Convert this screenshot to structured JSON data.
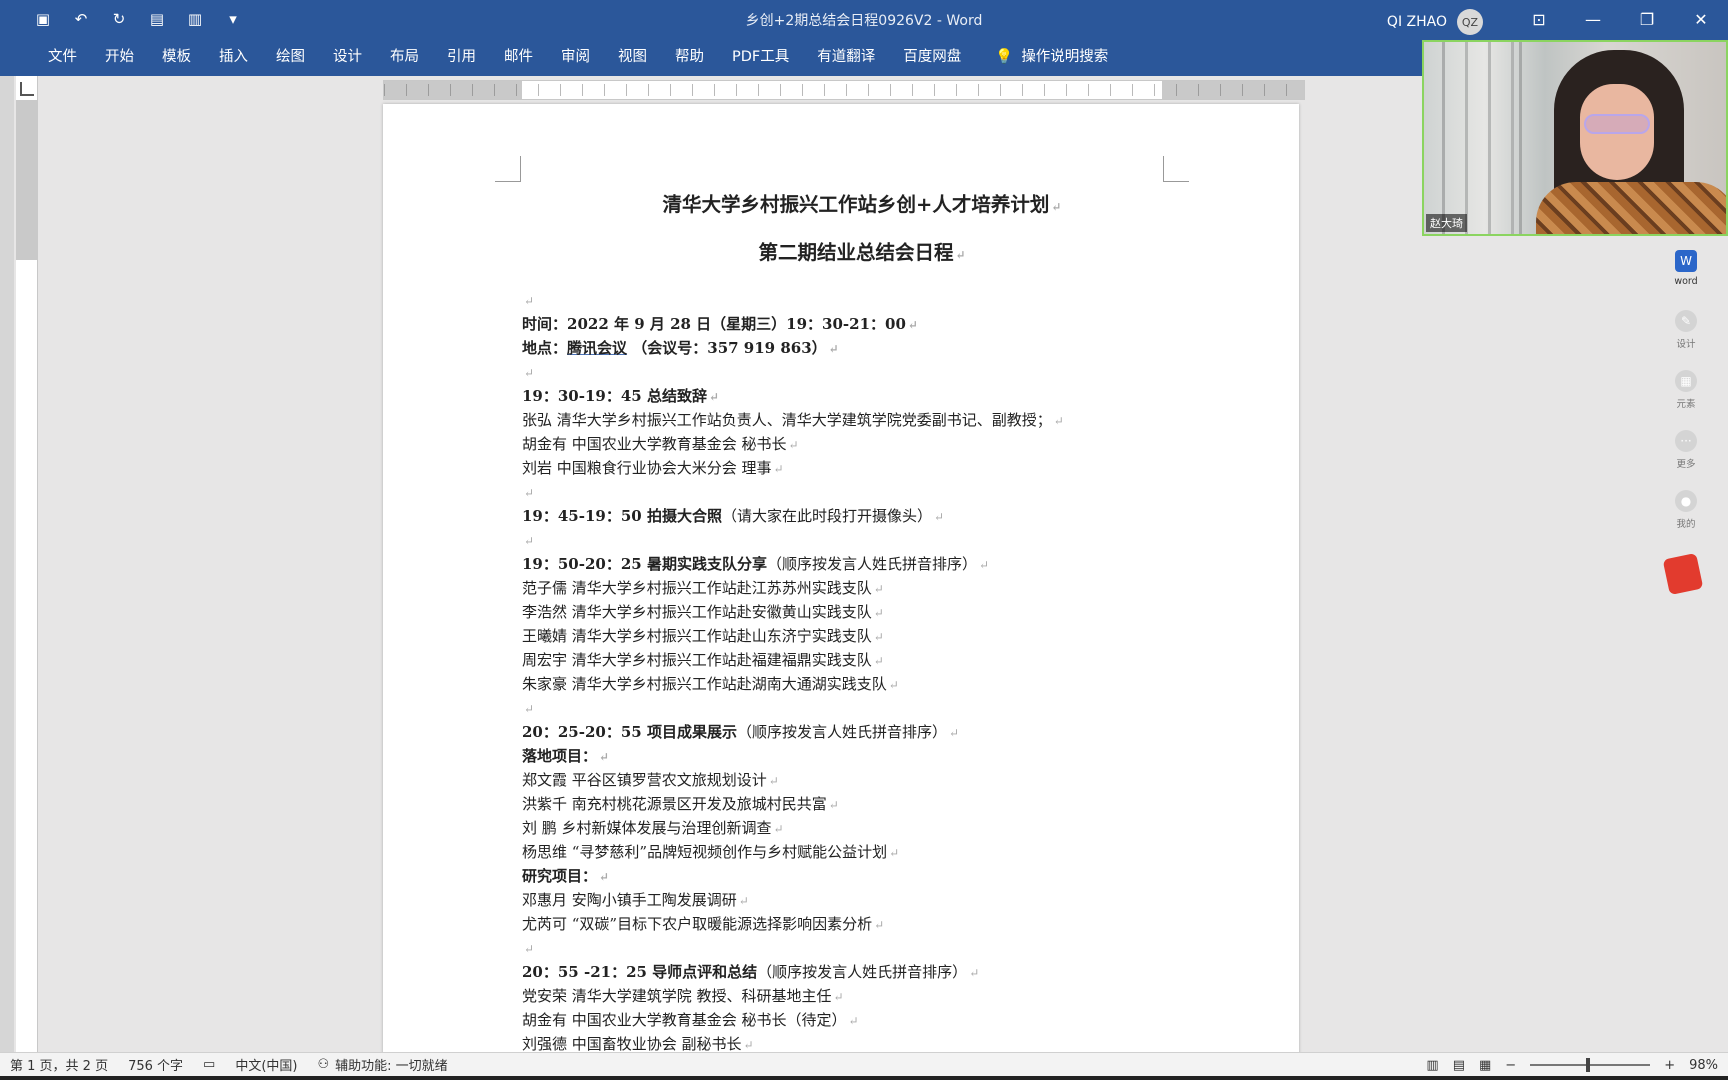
{
  "window": {
    "title": "乡创+2期总结会日程0926V2  -  Word",
    "user_name": "QI ZHAO",
    "user_initials": "QZ"
  },
  "ribbon": {
    "tabs": [
      "文件",
      "开始",
      "模板",
      "插入",
      "绘图",
      "设计",
      "布局",
      "引用",
      "邮件",
      "审阅",
      "视图",
      "帮助",
      "PDF工具",
      "有道翻译",
      "百度网盘"
    ],
    "search_label": "操作说明搜索"
  },
  "document": {
    "title1": "清华大学乡村振兴工作站乡创+人才培养计划",
    "title2": "第二期结业总结会日程",
    "time_label": "时间：",
    "time_value": "2022 年 9 月 28 日（星期三）19：30-21：00",
    "place_label": "地点：",
    "place_value": "腾讯会议",
    "place_meeting": " （会议号：357 919 863）",
    "s1_time": "19：30-19：45 总结致辞",
    "s1_lines": [
      "张弘    清华大学乡村振兴工作站负责人、清华大学建筑学院党委副书记、副教授；",
      "胡金有  中国农业大学教育基金会   秘书长",
      "刘岩    中国粮食行业协会大米分会  理事"
    ],
    "s2_time": "19：45-19：50 拍摄大合照",
    "s2_note": "（请大家在此时段打开摄像头）",
    "s3_time": "19：50-20：25 暑期实践支队分享",
    "s3_note": "（顺序按发言人姓氏拼音排序）",
    "s3_lines": [
      "范子儒 清华大学乡村振兴工作站赴江苏苏州实践支队",
      "李浩然 清华大学乡村振兴工作站赴安徽黄山实践支队",
      "王曦婧 清华大学乡村振兴工作站赴山东济宁实践支队",
      "周宏宇 清华大学乡村振兴工作站赴福建福鼎实践支队",
      "朱家豪 清华大学乡村振兴工作站赴湖南大通湖实践支队"
    ],
    "s4_time": "20：25-20：55 项目成果展示",
    "s4_note": "（顺序按发言人姓氏拼音排序）",
    "s4_sub1": "落地项目：",
    "s4_landing": [
      "郑文霞 平谷区镇罗营农文旅规划设计",
      "洪紫千 南充村桃花源景区开发及旅城村民共富",
      "刘 鹏 乡村新媒体发展与治理创新调查",
      "杨思维 “寻梦慈利”品牌短视频创作与乡村赋能公益计划"
    ],
    "s4_sub2": "研究项目：",
    "s4_research": [
      "邓惠月 安陶小镇手工陶发展调研",
      "尤芮可 “双碳”目标下农户取暖能源选择影响因素分析"
    ],
    "s5_time": "20：55 -21：25 导师点评和总结",
    "s5_note": "（顺序按发言人姓氏拼音排序）",
    "s5_lines": [
      "党安荣   清华大学建筑学院   教授、科研基地主任",
      "胡金有  中国农业大学教育基金会   秘书长（待定）",
      "刘强德   中国畜牧业协会 副秘书长"
    ],
    "pilcrow": "↵"
  },
  "video": {
    "name_tag": "赵大琦"
  },
  "sidebar": {
    "items": [
      {
        "label": "word",
        "icon": "word-icon"
      },
      {
        "label": "设计",
        "icon": "design-icon"
      },
      {
        "label": "元素",
        "icon": "elements-icon"
      },
      {
        "label": "更多",
        "icon": "more-icon"
      },
      {
        "label": "我的",
        "icon": "profile-icon"
      }
    ]
  },
  "status": {
    "page": "第 1 页，共 2 页",
    "words": "756 个字",
    "language": "中文(中国)",
    "accessibility": "辅助功能: 一切就绪",
    "zoom": "98%"
  }
}
